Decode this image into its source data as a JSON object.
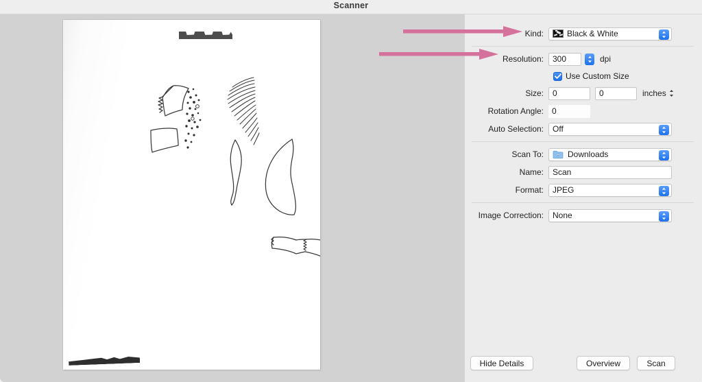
{
  "window": {
    "title": "Scanner"
  },
  "preview": {
    "document_description": "hand-drawn mushroom sketches on white paper",
    "marks": {
      "top_smudge": "dark-scan-artifact-top",
      "bottom_smudge": "dark-scan-artifact-bottom"
    }
  },
  "annotations": {
    "color": "#d4729b",
    "arrows": [
      {
        "name": "arrow-to-kind",
        "target": "Kind"
      },
      {
        "name": "arrow-to-resolution",
        "target": "Resolution"
      }
    ]
  },
  "settings": {
    "kind": {
      "label": "Kind:",
      "value": "Black & White",
      "icon": "image-thumbnail-icon"
    },
    "resolution": {
      "label": "Resolution:",
      "value": "300",
      "unit": "dpi"
    },
    "use_custom_size": {
      "label": "Use Custom Size",
      "checked": true
    },
    "size": {
      "label": "Size:",
      "width": "0",
      "height": "0",
      "unit": "inches"
    },
    "rotation_angle": {
      "label": "Rotation Angle:",
      "value": "0"
    },
    "auto_selection": {
      "label": "Auto Selection:",
      "value": "Off"
    },
    "scan_to": {
      "label": "Scan To:",
      "value": "Downloads",
      "icon": "downloads-folder-icon"
    },
    "name": {
      "label": "Name:",
      "value": "Scan"
    },
    "format": {
      "label": "Format:",
      "value": "JPEG"
    },
    "image_correction": {
      "label": "Image Correction:",
      "value": "None"
    }
  },
  "buttons": {
    "hide_details": "Hide Details",
    "overview": "Overview",
    "scan": "Scan"
  }
}
